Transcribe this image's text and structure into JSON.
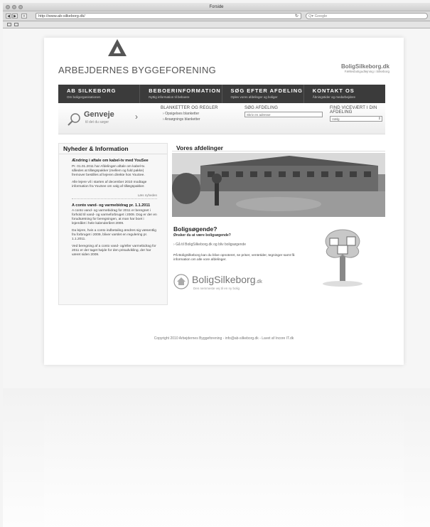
{
  "browser": {
    "window_title": "Forside",
    "url": "http://www.ab-silkeborg.dk/",
    "search_placeholder": "Google",
    "back_icon": "back-arrow-icon",
    "forward_icon": "forward-arrow-icon",
    "add_icon": "plus-icon",
    "reload_icon": "reload-icon"
  },
  "site": {
    "brand": "ARBEJDERNES BYGGEFORENING",
    "partner_name": "BoligSilkeborg.dk",
    "partner_tag": "Fællesboligudlejning i Silkeborg",
    "nav": [
      {
        "title": "AB SILKEBORG",
        "sub": "Om boligorganisationen"
      },
      {
        "title": "BEBOERINFORMATION",
        "sub": "Nyttig information til beboere"
      },
      {
        "title": "SØG EFTER AFDELING",
        "sub": "Oplev vores afdelinger og boliger"
      },
      {
        "title": "KONTAKT OS",
        "sub": "Åbningstider og medarbejdere"
      }
    ],
    "genveje": {
      "title": "Genveje",
      "sub": "til det du søger"
    },
    "blanketter": {
      "title": "BLANKETTER OG REGLER",
      "links": [
        "Opsigelses blanketter",
        "Ansøgnings blanketter"
      ]
    },
    "soeg": {
      "title": "SØG AFDELING",
      "placeholder": "Skriv en adresse"
    },
    "find": {
      "title": "FIND VICEVÆRT I DIN AFDELING",
      "select": "Vælg"
    },
    "news": {
      "heading": "Nyheder & Information",
      "items": [
        {
          "title": "Ændring i aftale om kabel-tv med YouSee",
          "text1": "Pr. 01.01.2011 har Afdelingen aftale om kabel-tv. således at tillægspakker (mellem og fuld pakke) fremover bestilles af lejeren direkte hos YouSee.",
          "text2": "Alle lejere vil i starten af december 2010 modtage information fra YouSee om valg af tillægspakker.",
          "more": "Læs nyheden"
        },
        {
          "title": "A conto vand- og varmebidrag pr. 1.1.2011",
          "text1": "A conto vand- og varmebidrag for 2011 er beregnet i forhold til vand- og varmeforbruget i 2009. Dog er der en forudsætning for beregningen, at man har boet i lejemålet i hele kalenderåret 2009.",
          "text2": "Da lejere, hvis a conto indbetaling ændres sig væsentlig fra forbruget i 2009, bliver varslet en regulering pr. 1.1.2011.",
          "text3": "Ved beregning af a conto vand- og/eller varmebidrag for 2011 er der taget højde for den prisudvikling, der har været siden 2009."
        }
      ]
    },
    "main": {
      "heading": "Vores afdelinger",
      "bolig_q": "Boligsøgende?",
      "bolig_sub": "Ønsker du at være boligsøgende?",
      "bolig_link": "Gå til BoligSilkeborg.dk og bliv boligsøgende",
      "bolig_text": "På BoligSilkeborg kan du blive opnoteret, se priser, ventetider, tegninger samt få information om alle vore afdelinger.",
      "bs_name": "BoligSilkeborg",
      "bs_suffix": ".dk",
      "bs_tag": "Den nemmeste vej til en ny bolig"
    },
    "footer": "Copyright 2010 Arbejdernes Byggeforening - info@ab-silkeborg.dk - Lavet af Incore IT.dk"
  }
}
